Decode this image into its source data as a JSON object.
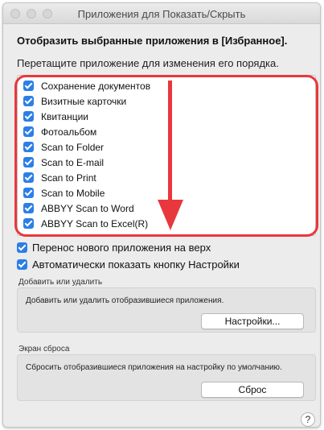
{
  "window": {
    "title": "Приложения для Показать/Скрыть"
  },
  "heading": "Отобразить выбранные приложения в [Избранное].",
  "subheading": "Перетащите приложение для изменения его порядка.",
  "apps": [
    {
      "label": "Сохранение документов",
      "checked": true
    },
    {
      "label": "Визитные карточки",
      "checked": true
    },
    {
      "label": "Квитанции",
      "checked": true
    },
    {
      "label": "Фотоальбом",
      "checked": true
    },
    {
      "label": "Scan to Folder",
      "checked": true
    },
    {
      "label": "Scan to E-mail",
      "checked": true
    },
    {
      "label": "Scan to Print",
      "checked": true
    },
    {
      "label": "Scan to Mobile",
      "checked": true
    },
    {
      "label": "ABBYY Scan to Word",
      "checked": true
    },
    {
      "label": "ABBYY Scan to Excel(R)",
      "checked": true
    }
  ],
  "options": {
    "move_new_to_top": {
      "label": "Перенос нового приложения на верх",
      "checked": true
    },
    "auto_show_settings": {
      "label": "Автоматически показать кнопку Настройки",
      "checked": true
    }
  },
  "add_remove": {
    "group_label": "Добавить или удалить",
    "description": "Добавить или удалить отобразившиеся приложения.",
    "button_label": "Настройки..."
  },
  "reset": {
    "group_label": "Экран сброса",
    "description": "Сбросить отобразившиеся приложения на настройку по умолчанию.",
    "button_label": "Сброс"
  },
  "help_label": "?",
  "colors": {
    "accent": "#2b7fe6",
    "annotation": "#e8383d"
  },
  "icons": {
    "checkbox": "checkbox-checked-icon",
    "arrow": "down-arrow-icon",
    "help": "help-icon"
  }
}
